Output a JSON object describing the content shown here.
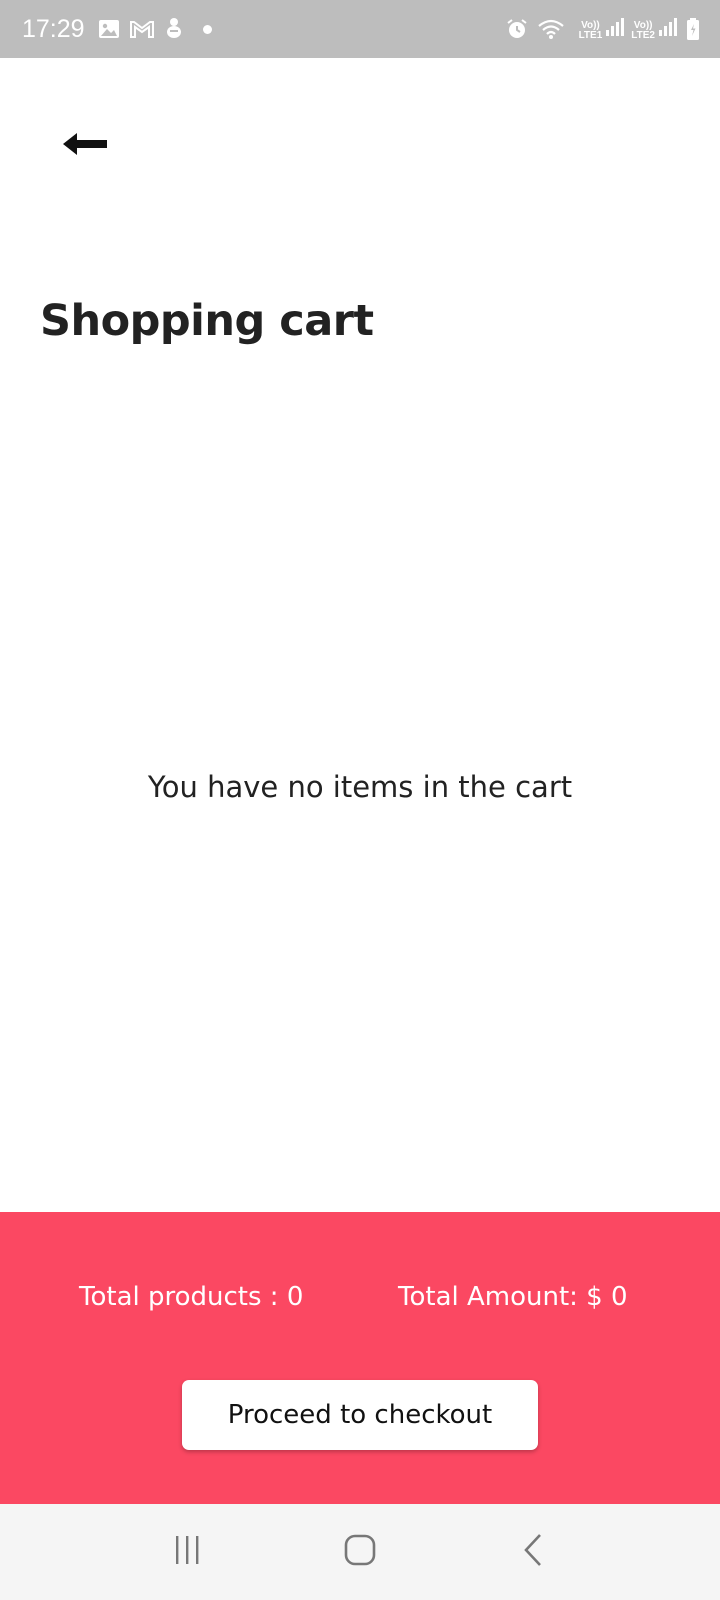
{
  "status_bar": {
    "time": "17:29",
    "sim1_label_top": "Vo))",
    "sim1_label_bottom": "LTE1",
    "sim2_label_top": "Vo))",
    "sim2_label_bottom": "LTE2",
    "icons": [
      "gallery-icon",
      "gmail-icon",
      "app-notification-icon",
      "dot-icon",
      "alarm-icon",
      "wifi-icon",
      "signal-icon",
      "battery-icon"
    ]
  },
  "header": {
    "back_icon": "arrow-left-icon",
    "title": "Shopping cart"
  },
  "cart": {
    "empty_message": "You have no items in the cart"
  },
  "summary": {
    "total_products": "Total products : 0",
    "total_amount": "Total Amount: $ 0",
    "checkout_label": "Proceed to checkout"
  },
  "nav_bar": {
    "icons": [
      "recents-icon",
      "home-icon",
      "back-nav-icon"
    ]
  },
  "colors": {
    "accent": "#fb4862",
    "status_bar": "#bdbdbd",
    "nav_bar": "#f5f5f5",
    "text": "#222222"
  }
}
